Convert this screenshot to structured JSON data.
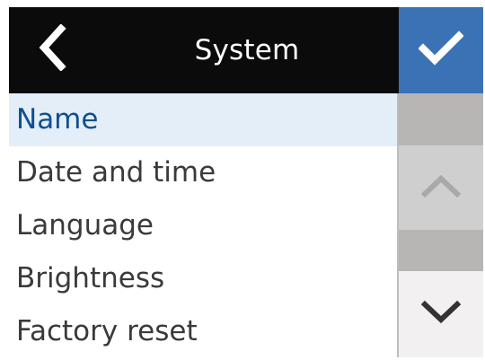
{
  "header": {
    "title": "System",
    "back_icon": "chevron-left-icon",
    "confirm_icon": "checkmark-icon"
  },
  "menu": {
    "items": [
      {
        "label": "Name",
        "selected": true
      },
      {
        "label": "Date and time",
        "selected": false
      },
      {
        "label": "Language",
        "selected": false
      },
      {
        "label": "Brightness",
        "selected": false
      },
      {
        "label": "Factory reset",
        "selected": false
      }
    ]
  },
  "scroll": {
    "up_icon": "chevron-up-icon",
    "down_icon": "chevron-down-icon"
  },
  "colors": {
    "header_bg": "#0b0b0b",
    "confirm_bg": "#3a72b5",
    "selected_bg": "#e4eef9",
    "selected_text": "#0e4f8f",
    "item_text": "#3a3a3a"
  }
}
